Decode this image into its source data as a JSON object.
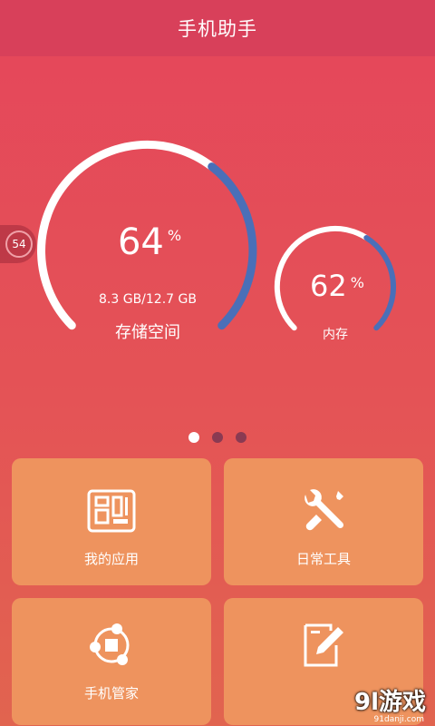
{
  "header": {
    "title": "手机助手"
  },
  "side_badge": {
    "value": "54"
  },
  "storage": {
    "percent": 64,
    "percent_text": "64",
    "unit": "%",
    "detail": "8.3 GB/12.7 GB",
    "label": "存储空间"
  },
  "memory": {
    "percent": 62,
    "percent_text": "62",
    "unit": "%",
    "label": "内存"
  },
  "pager": {
    "count": 3,
    "active_index": 0
  },
  "tiles": [
    {
      "label": "我的应用",
      "icon": "apps-grid-icon"
    },
    {
      "label": "日常工具",
      "icon": "tools-icon"
    },
    {
      "label": "手机管家",
      "icon": "manager-icon"
    },
    {
      "label": "",
      "icon": "edit-note-icon"
    }
  ],
  "watermark": {
    "text": "9l游戏",
    "sub": "91danji.com"
  },
  "colors": {
    "accent_blue": "#4a6fb8",
    "tile": "#ee935e",
    "header": "#d8405a"
  }
}
